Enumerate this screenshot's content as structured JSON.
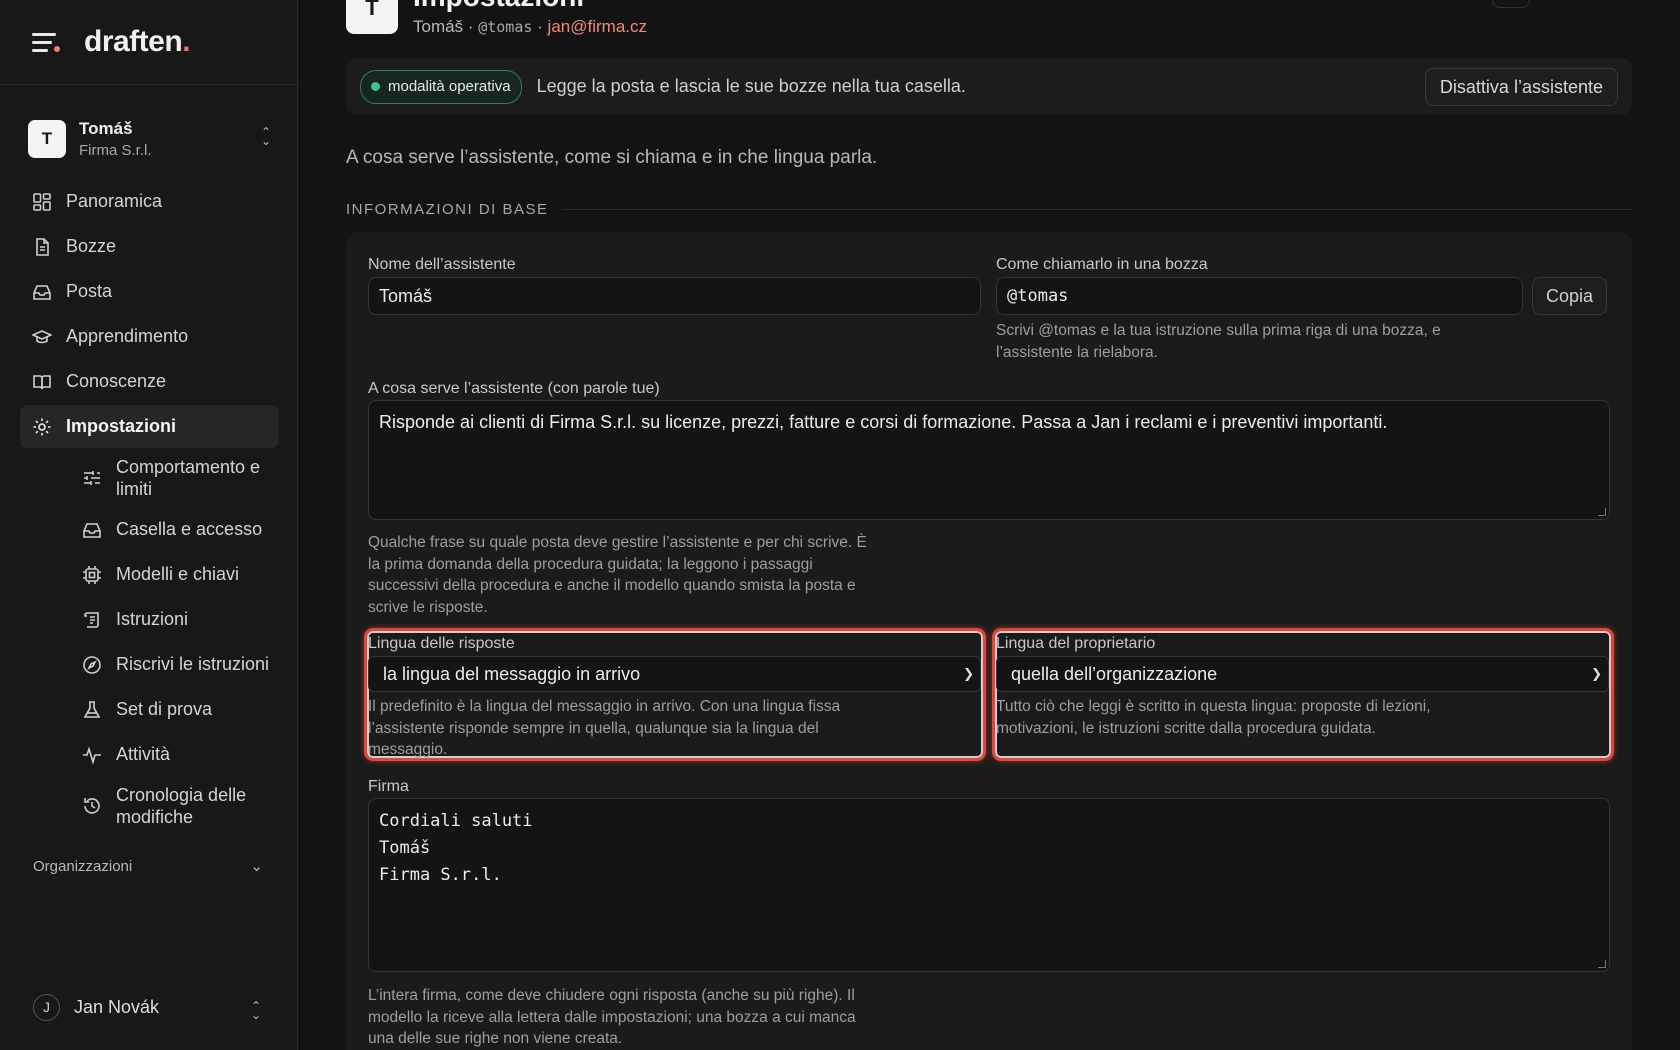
{
  "brand": {
    "name": "draften",
    "dot": "."
  },
  "account": {
    "initial": "T",
    "name": "Tomáš",
    "org": "Firma S.r.l."
  },
  "nav": {
    "items": [
      {
        "label": "Panoramica",
        "icon": "grid-icon"
      },
      {
        "label": "Bozze",
        "icon": "document-icon"
      },
      {
        "label": "Posta",
        "icon": "inbox-icon"
      },
      {
        "label": "Apprendimento",
        "icon": "graduation-cap-icon"
      },
      {
        "label": "Conoscenze",
        "icon": "book-icon"
      },
      {
        "label": "Impostazioni",
        "icon": "gear-icon",
        "active": true
      }
    ],
    "sub_items": [
      {
        "label": "Comportamento e limiti",
        "icon": "sliders-icon"
      },
      {
        "label": "Casella e accesso",
        "icon": "inbox-icon"
      },
      {
        "label": "Modelli e chiavi",
        "icon": "chip-icon"
      },
      {
        "label": "Istruzioni",
        "icon": "scroll-icon"
      },
      {
        "label": "Riscrivi le istruzioni",
        "icon": "compass-icon"
      },
      {
        "label": "Set di prova",
        "icon": "flask-icon"
      },
      {
        "label": "Attività",
        "icon": "activity-icon"
      },
      {
        "label": "Cronologia delle modifiche",
        "icon": "history-icon"
      }
    ],
    "organizations_label": "Organizzazioni"
  },
  "user": {
    "initial": "J",
    "name": "Jan Novák"
  },
  "header": {
    "title": "Impostazioni",
    "name": "Tomáš",
    "sep": "·",
    "handle": "@tomas",
    "email": "jan@firma.cz"
  },
  "status": {
    "badge": "modalità operativa",
    "text": "Legge la posta e lascia le sue bozze nella tua casella.",
    "deactivate_label": "Disattiva l’assistente"
  },
  "intro": "A cosa serve l’assistente, come si chiama e in che lingua parla.",
  "section_title": "INFORMAZIONI DI BASE",
  "form": {
    "name_label": "Nome dell’assistente",
    "name_value": "Tomáš",
    "mention_label": "Come chiamarlo in una bozza",
    "mention_value": "@tomas",
    "copy_label": "Copia",
    "mention_help": "Scrivi @tomas e la tua istruzione sulla prima riga di una bozza, e l’assistente la rielabora.",
    "purpose_label": "A cosa serve l’assistente (con parole tue)",
    "purpose_value": "Risponde ai clienti di Firma S.r.l. su licenze, prezzi, fatture e corsi di formazione. Passa a Jan i reclami e i preventivi importanti.",
    "purpose_help": "Qualche frase su quale posta deve gestire l’assistente e per chi scrive. È la prima domanda della procedura guidata; la leggono i passaggi successivi della procedura e anche il modello quando smista la posta e scrive le risposte.",
    "reply_lang_label": "Lingua delle risposte",
    "reply_lang_value": "la lingua del messaggio in arrivo",
    "reply_lang_help": "Il predefinito è la lingua del messaggio in arrivo. Con una lingua fissa l’assistente risponde sempre in quella, qualunque sia la lingua del messaggio.",
    "owner_lang_label": "Lingua del proprietario",
    "owner_lang_value": "quella dell’organizzazione",
    "owner_lang_help": "Tutto ciò che leggi è scritto in questa lingua: proposte di lezioni, motivazioni, le istruzioni scritte dalla procedura guidata.",
    "signature_label": "Firma",
    "signature_lines": [
      "Cordiali saluti",
      "Tomáš",
      "Firma S.r.l."
    ],
    "signature_help": "L’intera firma, come deve chiudere ogni risposta (anche su più righe). Il modello la riceve alla lettera dalle impostazioni; una bozza a cui manca una delle sue righe non viene creata."
  },
  "colors": {
    "accent": "#f0735f",
    "highlight": "#e0473a",
    "status_green": "#3ec28a"
  }
}
